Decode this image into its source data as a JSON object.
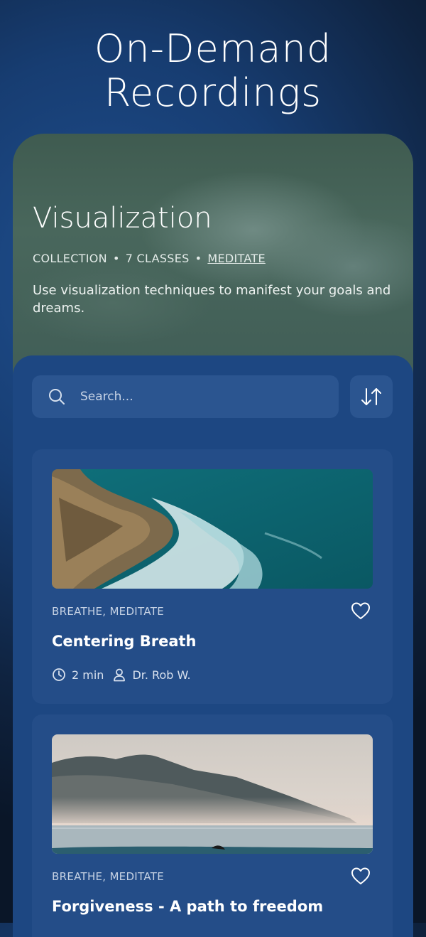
{
  "hero": {
    "title_line1": "On-Demand",
    "title_line2": "Recordings"
  },
  "collection": {
    "title": "Visualization",
    "meta": {
      "type": "COLLECTION",
      "classes": "7 CLASSES",
      "category": "MEDITATE",
      "separator": "•"
    },
    "description": "Use visualization techniques to manifest your goals and dreams."
  },
  "search": {
    "placeholder": "Search..."
  },
  "recordings": [
    {
      "tags": "BREATHE, MEDITATE",
      "title": "Centering Breath",
      "duration": "2 min",
      "instructor": "Dr. Rob W.",
      "image": "ocean-rocks"
    },
    {
      "tags": "BREATHE, MEDITATE",
      "title": "Forgiveness - A path to freedom",
      "image": "misty-mountains"
    }
  ],
  "icons": {
    "search": "search-icon",
    "sort": "sort-icon",
    "heart": "heart-icon",
    "clock": "clock-icon",
    "user": "user-icon"
  },
  "colors": {
    "background": "#173d72",
    "card": "#244d88",
    "header": "#49675c",
    "text": "#ffffff"
  }
}
